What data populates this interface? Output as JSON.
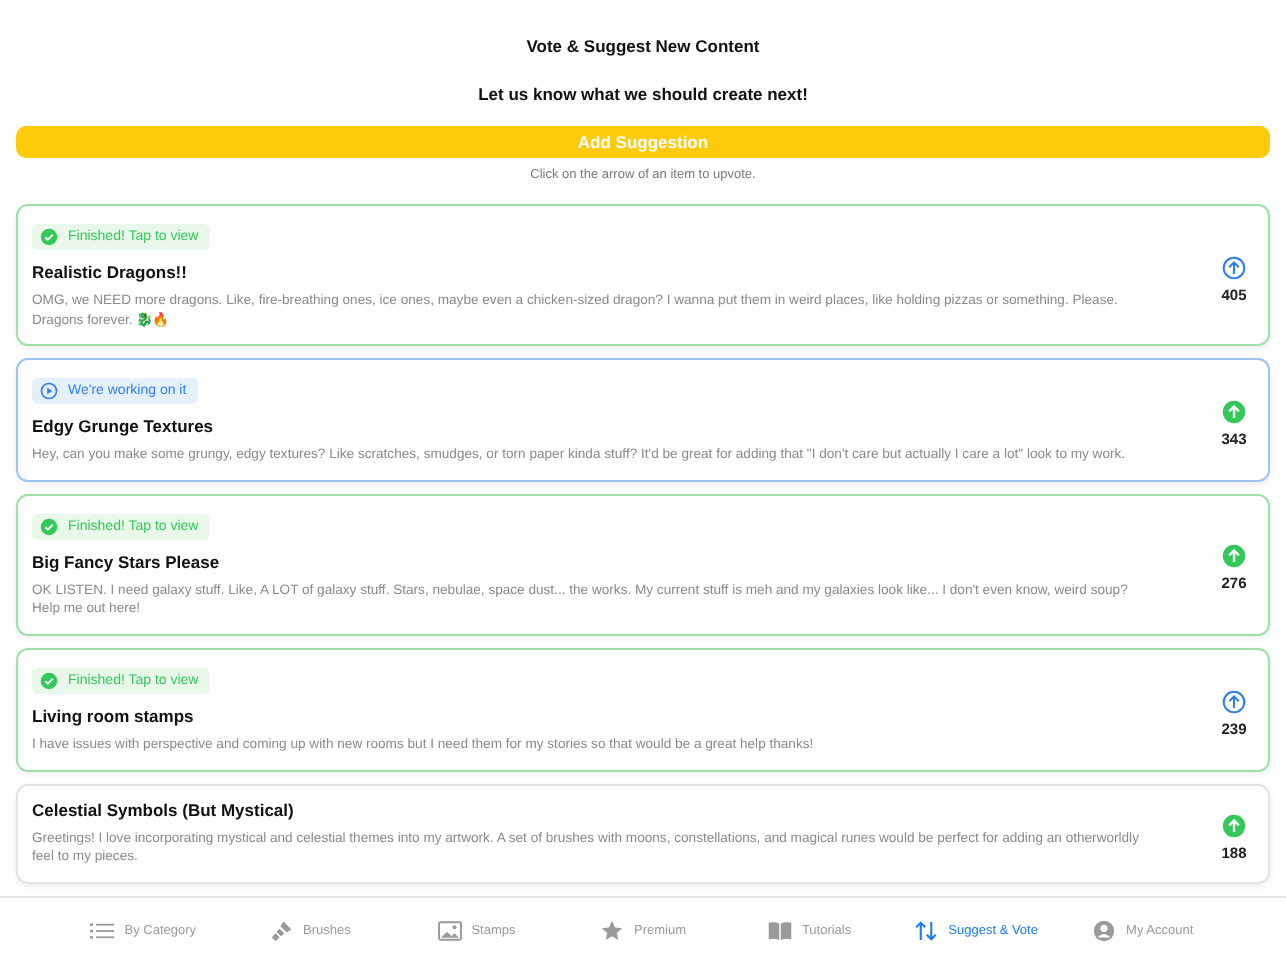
{
  "header": {
    "title": "Vote & Suggest New Content",
    "subtitle": "Let us know what we should create next!"
  },
  "add_button": "Add Suggestion",
  "hint": "Click on the arrow of an item to upvote.",
  "suggestions": [
    {
      "status": {
        "kind": "finished",
        "label": "Finished! Tap to view"
      },
      "title": "Realistic Dragons!!",
      "description": "OMG, we NEED more dragons. Like, fire-breathing ones, ice ones, maybe even a chicken-sized dragon? I wanna put them in weird places, like holding pizzas or something. Please. Dragons forever. 🐉🔥",
      "voted": false,
      "votes": "405"
    },
    {
      "status": {
        "kind": "working",
        "label": "We're working on it"
      },
      "title": "Edgy Grunge Textures",
      "description": "Hey, can you make some grungy, edgy textures? Like scratches, smudges, or torn paper kinda stuff? It'd be great for adding that \"I don't care but actually I care a lot\" look to my work.",
      "voted": true,
      "votes": "343"
    },
    {
      "status": {
        "kind": "finished",
        "label": "Finished! Tap to view"
      },
      "title": "Big Fancy Stars Please",
      "description": "OK LISTEN. I need galaxy stuff. Like, A LOT of galaxy stuff. Stars, nebulae, space dust... the works. My current stuff is meh and my galaxies look like... I don't even know, weird soup? Help me out here!",
      "voted": true,
      "votes": "276"
    },
    {
      "status": {
        "kind": "finished",
        "label": "Finished! Tap to view"
      },
      "title": "Living room stamps",
      "description": "I have issues with perspective and coming up with new rooms but I need them for my stories so that would be a great help thanks!",
      "voted": false,
      "votes": "239"
    },
    {
      "title": "Celestial Symbols (But Mystical)",
      "description": "Greetings! I love incorporating mystical and celestial themes into my artwork. A set of brushes with moons, constellations, and magical runes would be perfect for adding an otherworldly feel to my pieces.",
      "voted": true,
      "votes": "188"
    }
  ],
  "tab_bar": [
    {
      "kind": "list",
      "label": "By Category",
      "selected": false
    },
    {
      "kind": "brush",
      "label": "Brushes",
      "selected": false
    },
    {
      "kind": "image",
      "label": "Stamps",
      "selected": false
    },
    {
      "kind": "star",
      "label": "Premium",
      "selected": false
    },
    {
      "kind": "book",
      "label": "Tutorials",
      "selected": false
    },
    {
      "kind": "arrows",
      "label": "Suggest & Vote",
      "selected": true
    },
    {
      "kind": "person",
      "label": "My Account",
      "selected": false
    }
  ]
}
